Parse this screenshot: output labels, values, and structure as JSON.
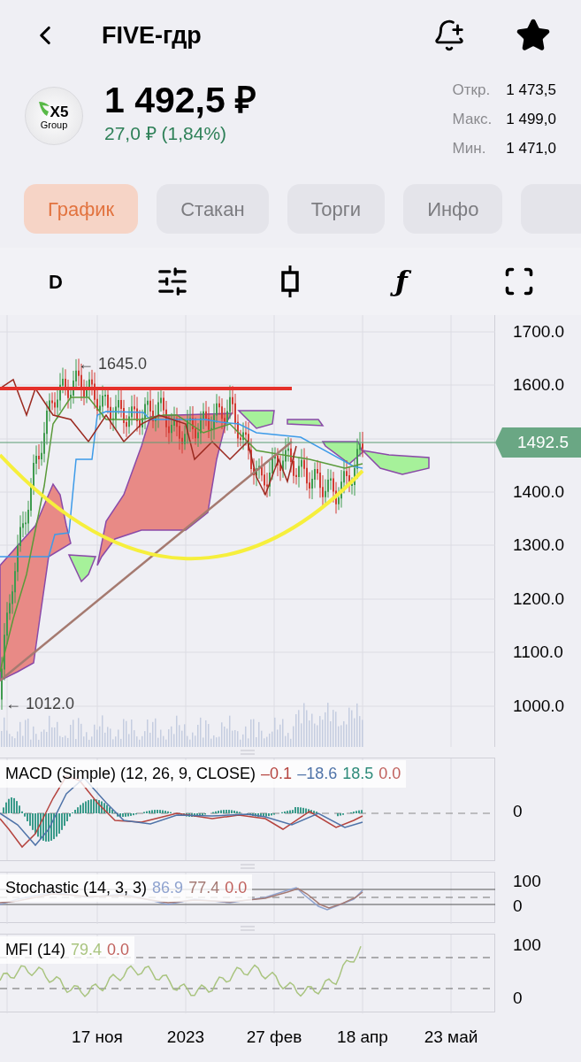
{
  "header": {
    "title": "FIVE-гдр"
  },
  "quote": {
    "logo_text": "X5",
    "logo_subtext": "Group",
    "price": "1 492,5 ₽",
    "change": "27,0 ₽ (1,84%)",
    "change_positive": true
  },
  "stats": [
    {
      "label": "Откр.",
      "value": "1 473,5"
    },
    {
      "label": "Макс.",
      "value": "1 499,0"
    },
    {
      "label": "Мин.",
      "value": "1 471,0"
    }
  ],
  "tabs": [
    {
      "label": "График",
      "selected": true
    },
    {
      "label": "Стакан",
      "selected": false
    },
    {
      "label": "Торги",
      "selected": false
    },
    {
      "label": "Инфо",
      "selected": false
    }
  ],
  "more_tab_cut": true,
  "toolbar": {
    "period": "D",
    "function_glyph": "ƒ"
  },
  "chart": {
    "y_axis": [
      "1700.0",
      "1600.0",
      "1400.0",
      "1300.0",
      "1200.0",
      "1100.0",
      "1000.0"
    ],
    "last_price": "1492.5",
    "high_marker": "← 1645.0",
    "low_marker": "← 1012.0"
  },
  "macd": {
    "title": "MACD (Simple) (12, 26, 9, CLOSE)",
    "values": [
      {
        "text": "–0.1",
        "color": "#b5443f"
      },
      {
        "text": "–18.6",
        "color": "#4f73a8"
      },
      {
        "text": "18.5",
        "color": "#2e8b7a"
      },
      {
        "text": "0.0",
        "color": "#c0605c"
      }
    ],
    "axis": [
      "0"
    ]
  },
  "stochastic": {
    "title": "Stochastic (14, 3, 3)",
    "values": [
      {
        "text": "86.9",
        "color": "#8fa3cf"
      },
      {
        "text": "77.4",
        "color": "#a47a74"
      },
      {
        "text": "0.0",
        "color": "#c0605c"
      }
    ],
    "axis": [
      "100",
      "0"
    ]
  },
  "mfi": {
    "title": "MFI (14)",
    "values": [
      {
        "text": "79.4",
        "color": "#a9c47f"
      },
      {
        "text": "0.0",
        "color": "#c0605c"
      }
    ],
    "axis": [
      "100",
      "0"
    ]
  },
  "x_axis": [
    "17 ноя",
    "2023",
    "27 фев",
    "18 апр",
    "23 май"
  ]
}
